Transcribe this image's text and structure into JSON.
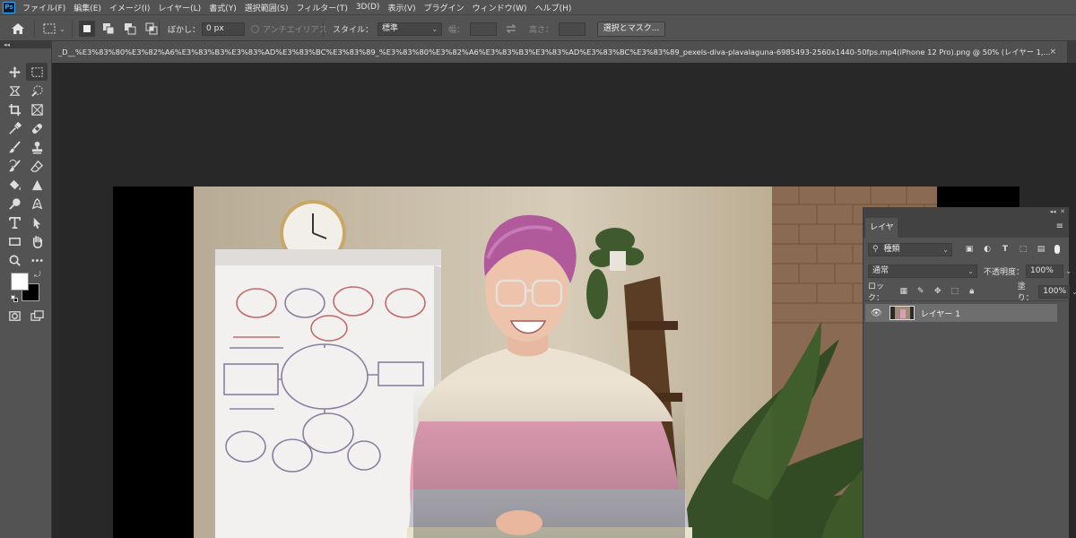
{
  "app": {
    "logo": "Ps"
  },
  "menubar": {
    "items": [
      "ファイル(F)",
      "編集(E)",
      "イメージ(I)",
      "レイヤー(L)",
      "書式(Y)",
      "選択範囲(S)",
      "フィルター(T)",
      "3D(D)",
      "表示(V)",
      "プラグイン",
      "ウィンドウ(W)",
      "ヘルプ(H)"
    ]
  },
  "options": {
    "feather_label": "ぼかし：",
    "feather_value": "0 px",
    "antialias_label": "アンチエイリアス",
    "style_label": "スタイル：",
    "style_value": "標準",
    "width_label": "幅：",
    "height_label": "高さ：",
    "select_mask_button": "選択とマスク..."
  },
  "document": {
    "tab_title": "_D__%E3%83%80%E3%82%A6%E3%83%B3%E3%83%AD%E3%83%BC%E3%83%89_%E3%83%80%E3%82%A6%E3%83%B3%E3%83%AD%E3%83%BC%E3%83%89_pexels-diva-plavalaguna-6985493-2560x1440-50fps.mp4(iPhone 12 Pro).png @ 50% (レイヤー 1,...",
    "tab_close": "×"
  },
  "layers_panel": {
    "tab_label": "レイヤー",
    "filter_value": "種類",
    "blend_mode": "通常",
    "opacity_label": "不透明度：",
    "opacity_value": "100%",
    "lock_label": "ロック：",
    "fill_label": "塗り：",
    "fill_value": "100%",
    "layers": [
      {
        "name": "レイヤー 1",
        "visible": true,
        "selected": true
      }
    ]
  },
  "colors": {
    "foreground": "#ffffff",
    "background": "#000000",
    "ui_panel": "#535353",
    "canvas_bg": "#282828"
  }
}
